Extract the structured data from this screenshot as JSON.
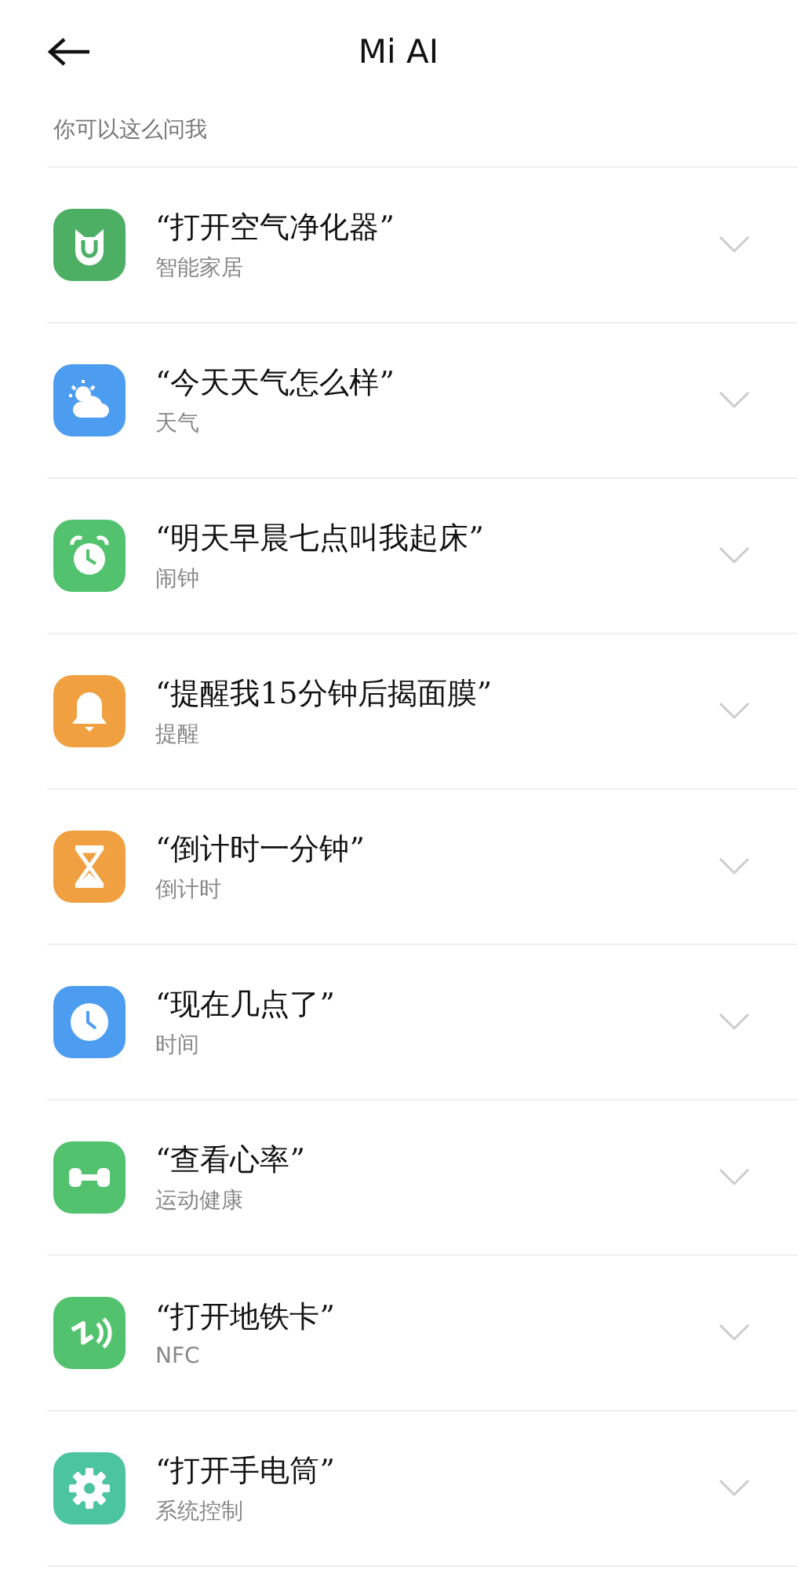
{
  "header": {
    "title": "Mi AI"
  },
  "section_label": "你可以这么问我",
  "items": [
    {
      "kind": "home",
      "color": "#4caf64",
      "query": "“打开空气净化器”",
      "category": "智能家居",
      "expanded": false
    },
    {
      "kind": "weather",
      "color": "#4c9cf0",
      "query": "“今天天气怎么样”",
      "category": "天气",
      "expanded": false
    },
    {
      "kind": "alarm",
      "color": "#52c26e",
      "query": "“明天早晨七点叫我起床”",
      "category": "闹钟",
      "expanded": false
    },
    {
      "kind": "reminder",
      "color": "#f0a040",
      "query": "“提醒我15分钟后揭面膜”",
      "category": "提醒",
      "expanded": false
    },
    {
      "kind": "timer",
      "color": "#f0a040",
      "query": "“倒计时一分钟”",
      "category": "倒计时",
      "expanded": false
    },
    {
      "kind": "clock",
      "color": "#4c9cf0",
      "query": "“现在几点了”",
      "category": "时间",
      "expanded": false
    },
    {
      "kind": "fitness",
      "color": "#52c26e",
      "query": "“查看心率”",
      "category": "运动健康",
      "expanded": false
    },
    {
      "kind": "nfc",
      "color": "#52c26e",
      "query": "“打开地铁卡”",
      "category": "NFC",
      "expanded": false
    },
    {
      "kind": "settings",
      "color": "#4cc4a0",
      "query": "“打开手电筒”",
      "category": "系统控制",
      "expanded": false
    }
  ]
}
